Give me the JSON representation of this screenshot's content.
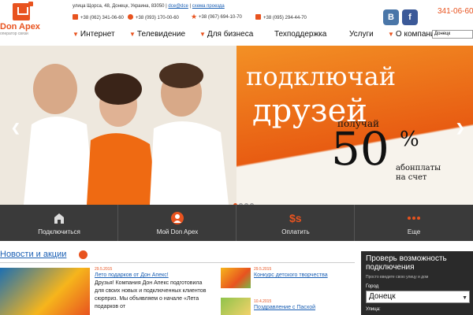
{
  "logo": {
    "name": "Don Apex",
    "subtitle": "оператор связи"
  },
  "header": {
    "address": "улица Щорса, 48, Донецк, Украина, 83050",
    "email": "dce@dce",
    "map_link": "схема проезда",
    "phones": [
      {
        "number": "+38 (062) 341-06-60",
        "icon": "phone-icon"
      },
      {
        "number": "+38 (093) 170-00-60",
        "icon": "life-icon"
      },
      {
        "number": "+38 (067) 694-10-70",
        "icon": "kyivstar-icon"
      },
      {
        "number": "+38 (095) 294-44-70",
        "icon": "mts-icon"
      }
    ],
    "social": [
      "В",
      "f"
    ],
    "main_phone": "341-06-60",
    "language": "Донецк"
  },
  "menu": [
    {
      "label": "Интернет",
      "has_arrow": true
    },
    {
      "label": "Телевидение",
      "has_arrow": true
    },
    {
      "label": "Для бизнеса",
      "has_arrow": true
    },
    {
      "label": "Техподдержка",
      "has_arrow": false
    },
    {
      "label": "Услуги",
      "has_arrow": false
    },
    {
      "label": "О компании",
      "has_arrow": true
    }
  ],
  "banner": {
    "line1": "подключай",
    "line2": "друзей",
    "get": "получай",
    "percent": "50",
    "percent_sign": "%",
    "note_line1": "абонплаты",
    "note_line2": "на счет",
    "slides": 4,
    "active_slide": 1
  },
  "actions": [
    {
      "label": "Подключиться",
      "icon": "house-icon"
    },
    {
      "label": "Мой Don Apex",
      "icon": "user-icon"
    },
    {
      "label": "Оплатить",
      "icon": "money-icon"
    },
    {
      "label": "Еще",
      "icon": "more-icon"
    }
  ],
  "news": {
    "heading": "Новости и акции",
    "items": [
      {
        "date": "29.5.2015",
        "title": "Лето подарков от Дон Апекс!",
        "text": "Друзья! Компания Дон Апекс подготовила для своих новых и подключенных клиентов сюрприз. Мы объявляем о начале «Лета подарков от"
      },
      {
        "date": "29.5.2015",
        "title": "Конкурс детского творчества"
      },
      {
        "date": "10.4.2015",
        "title": "Поздравление с Пасхой"
      }
    ]
  },
  "coverage": {
    "title": "Проверь возможность подключения",
    "subtitle": "Просто введите свою улицу и дом",
    "city_label": "Город",
    "city_value": "Донецк",
    "street_label": "Улица:"
  },
  "colors": {
    "accent": "#e8531f",
    "dark_bar": "#3a3a3a",
    "link": "#1a5fb4",
    "panel": "#2a2a2a"
  }
}
